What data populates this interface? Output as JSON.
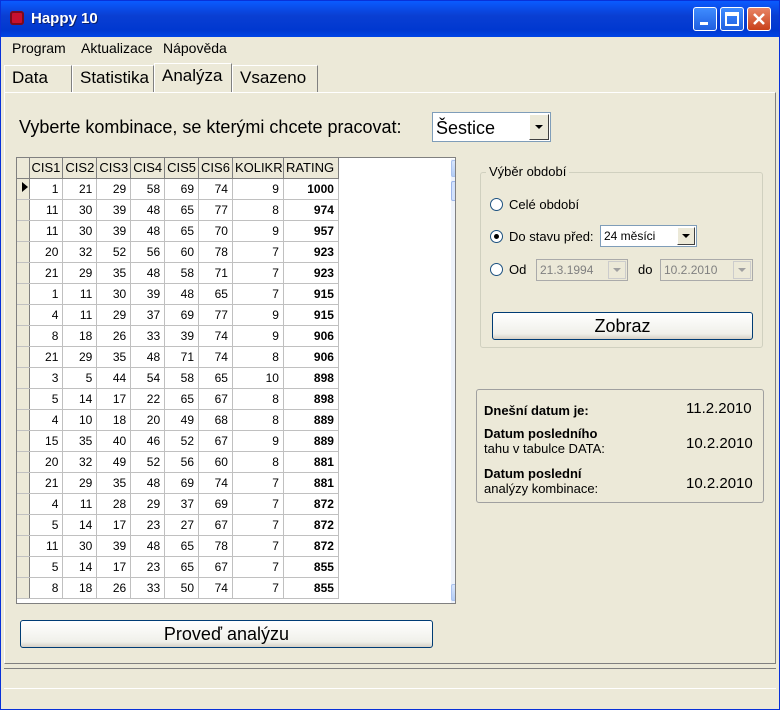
{
  "window": {
    "title": "Happy 10"
  },
  "menu": [
    "Program",
    "Aktualizace",
    "Nápověda"
  ],
  "tabs": [
    "Data",
    "Statistika",
    "Analýza",
    "Vsazeno"
  ],
  "prompt": "Vyberte kombinace, se kterými chcete pracovat:",
  "combination_select": {
    "value": "Šestice"
  },
  "grid": {
    "columns": [
      "CIS1",
      "CIS2",
      "CIS3",
      "CIS4",
      "CIS5",
      "CIS6",
      "KOLIKR",
      "RATING"
    ],
    "rows": [
      [
        "1",
        "21",
        "29",
        "58",
        "69",
        "74",
        "9",
        "1000"
      ],
      [
        "11",
        "30",
        "39",
        "48",
        "65",
        "77",
        "8",
        "974"
      ],
      [
        "11",
        "30",
        "39",
        "48",
        "65",
        "70",
        "9",
        "957"
      ],
      [
        "20",
        "32",
        "52",
        "56",
        "60",
        "78",
        "7",
        "923"
      ],
      [
        "21",
        "29",
        "35",
        "48",
        "58",
        "71",
        "7",
        "923"
      ],
      [
        "1",
        "11",
        "30",
        "39",
        "48",
        "65",
        "7",
        "915"
      ],
      [
        "4",
        "11",
        "29",
        "37",
        "69",
        "77",
        "9",
        "915"
      ],
      [
        "8",
        "18",
        "26",
        "33",
        "39",
        "74",
        "9",
        "906"
      ],
      [
        "21",
        "29",
        "35",
        "48",
        "71",
        "74",
        "8",
        "906"
      ],
      [
        "3",
        "5",
        "44",
        "54",
        "58",
        "65",
        "10",
        "898"
      ],
      [
        "5",
        "14",
        "17",
        "22",
        "65",
        "67",
        "8",
        "898"
      ],
      [
        "4",
        "10",
        "18",
        "20",
        "49",
        "68",
        "8",
        "889"
      ],
      [
        "15",
        "35",
        "40",
        "46",
        "52",
        "67",
        "9",
        "889"
      ],
      [
        "20",
        "32",
        "49",
        "52",
        "56",
        "60",
        "8",
        "881"
      ],
      [
        "21",
        "29",
        "35",
        "48",
        "69",
        "74",
        "7",
        "881"
      ],
      [
        "4",
        "11",
        "28",
        "29",
        "37",
        "69",
        "7",
        "872"
      ],
      [
        "5",
        "14",
        "17",
        "23",
        "27",
        "67",
        "7",
        "872"
      ],
      [
        "11",
        "30",
        "39",
        "48",
        "65",
        "78",
        "7",
        "872"
      ],
      [
        "5",
        "14",
        "17",
        "23",
        "65",
        "67",
        "7",
        "855"
      ],
      [
        "8",
        "18",
        "26",
        "33",
        "50",
        "74",
        "7",
        "855"
      ]
    ]
  },
  "period": {
    "legend": "Výběr období",
    "option_all": "Celé období",
    "option_until": "Do stavu před:",
    "until_value": "24 měsíci",
    "option_from": "Od",
    "from_value": "21.3.1994",
    "to_label": "do",
    "to_value": "10.2.2010",
    "show_button": "Zobraz"
  },
  "info": {
    "today_label": "Dnešní datum je:",
    "today_value": "11.2.2010",
    "last_draw_label_1": "Datum posledního",
    "last_draw_label_2": "tahu v tabulce DATA:",
    "last_draw_value": "10.2.2010",
    "last_analysis_label_1": "Datum poslední",
    "last_analysis_label_2": "analýzy kombinace:",
    "last_analysis_value": "10.2.2010"
  },
  "analyze_button": "Proveď analýzu"
}
